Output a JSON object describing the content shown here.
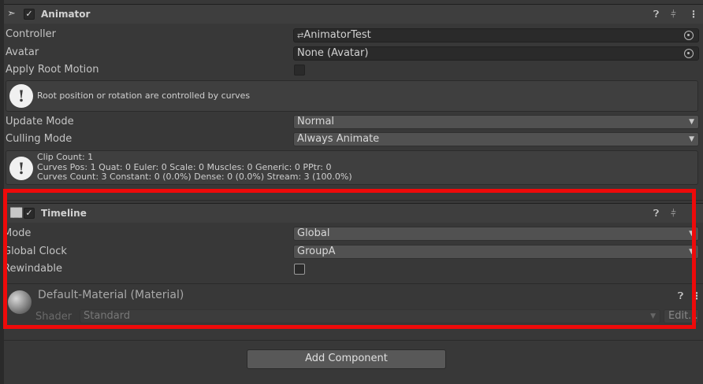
{
  "animator": {
    "title": "Animator",
    "enabled": true,
    "icons": [
      "help-icon",
      "preset-icon",
      "more-icon"
    ],
    "fields": {
      "controller_label": "Controller",
      "controller_value": "AnimatorTest",
      "avatar_label": "Avatar",
      "avatar_value": "None (Avatar)",
      "apply_root_motion_label": "Apply Root Motion",
      "root_motion_note": "Root position or rotation are controlled by curves",
      "update_mode_label": "Update Mode",
      "update_mode_value": "Normal",
      "culling_mode_label": "Culling Mode",
      "culling_mode_value": "Always Animate"
    },
    "stats": {
      "line1": "Clip Count: 1",
      "line2": "Curves Pos: 1 Quat: 0 Euler: 0 Scale: 0 Muscles: 0 Generic: 0 PPtr: 0",
      "line3": "Curves Count: 3 Constant: 0 (0.0%) Dense: 0 (0.0%) Stream: 3 (100.0%)"
    }
  },
  "timeline": {
    "title": "Timeline",
    "enabled": true,
    "mode_label": "Mode",
    "mode_value": "Global",
    "global_clock_label": "Global Clock",
    "global_clock_value": "GroupA",
    "rewindable_label": "Rewindable",
    "rewindable_checked": false
  },
  "material": {
    "title": "Default-Material (Material)",
    "shader_label": "Shader",
    "shader_value": "Standard",
    "edit_label": "Edit..."
  },
  "add_component_label": "Add Component",
  "colors": {
    "panel_bg": "#383838",
    "highlight": "#ee0a0a"
  }
}
